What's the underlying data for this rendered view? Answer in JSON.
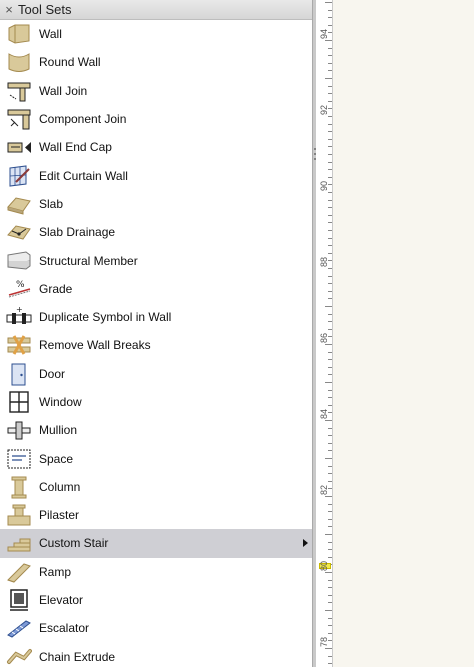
{
  "palette": {
    "title": "Tool Sets",
    "close_glyph": "×",
    "tools": [
      {
        "label": "Wall",
        "icon": "wall-icon",
        "selected": false
      },
      {
        "label": "Round Wall",
        "icon": "round-wall-icon",
        "selected": false
      },
      {
        "label": "Wall Join",
        "icon": "wall-join-icon",
        "selected": false
      },
      {
        "label": "Component Join",
        "icon": "component-join-icon",
        "selected": false
      },
      {
        "label": "Wall End Cap",
        "icon": "wall-end-cap-icon",
        "selected": false
      },
      {
        "label": "Edit Curtain Wall",
        "icon": "edit-curtain-wall-icon",
        "selected": false
      },
      {
        "label": "Slab",
        "icon": "slab-icon",
        "selected": false
      },
      {
        "label": "Slab Drainage",
        "icon": "slab-drainage-icon",
        "selected": false
      },
      {
        "label": "Structural Member",
        "icon": "structural-member-icon",
        "selected": false
      },
      {
        "label": "Grade",
        "icon": "grade-icon",
        "selected": false
      },
      {
        "label": "Duplicate Symbol in Wall",
        "icon": "duplicate-symbol-in-wall-icon",
        "selected": false
      },
      {
        "label": "Remove Wall Breaks",
        "icon": "remove-wall-breaks-icon",
        "selected": false
      },
      {
        "label": "Door",
        "icon": "door-icon",
        "selected": false
      },
      {
        "label": "Window",
        "icon": "window-icon",
        "selected": false
      },
      {
        "label": "Mullion",
        "icon": "mullion-icon",
        "selected": false
      },
      {
        "label": "Space",
        "icon": "space-icon",
        "selected": false
      },
      {
        "label": "Column",
        "icon": "column-icon",
        "selected": false
      },
      {
        "label": "Pilaster",
        "icon": "pilaster-icon",
        "selected": false
      },
      {
        "label": "Custom Stair",
        "icon": "custom-stair-icon",
        "selected": true,
        "has_submenu": true
      },
      {
        "label": "Ramp",
        "icon": "ramp-icon",
        "selected": false
      },
      {
        "label": "Elevator",
        "icon": "elevator-icon",
        "selected": false
      },
      {
        "label": "Escalator",
        "icon": "escalator-icon",
        "selected": false
      },
      {
        "label": "Chain Extrude",
        "icon": "chain-extrude-icon",
        "selected": false
      }
    ]
  },
  "ruler": {
    "labels": [
      "94",
      "92",
      "90",
      "88",
      "86",
      "84",
      "82",
      "80",
      "78"
    ],
    "marker_label": "80",
    "marker_color": "#f3ea4a"
  },
  "colors": {
    "selection": "#cfcfd4",
    "canvas": "#f8f6ef",
    "icon_tan": "#d9c99a"
  }
}
